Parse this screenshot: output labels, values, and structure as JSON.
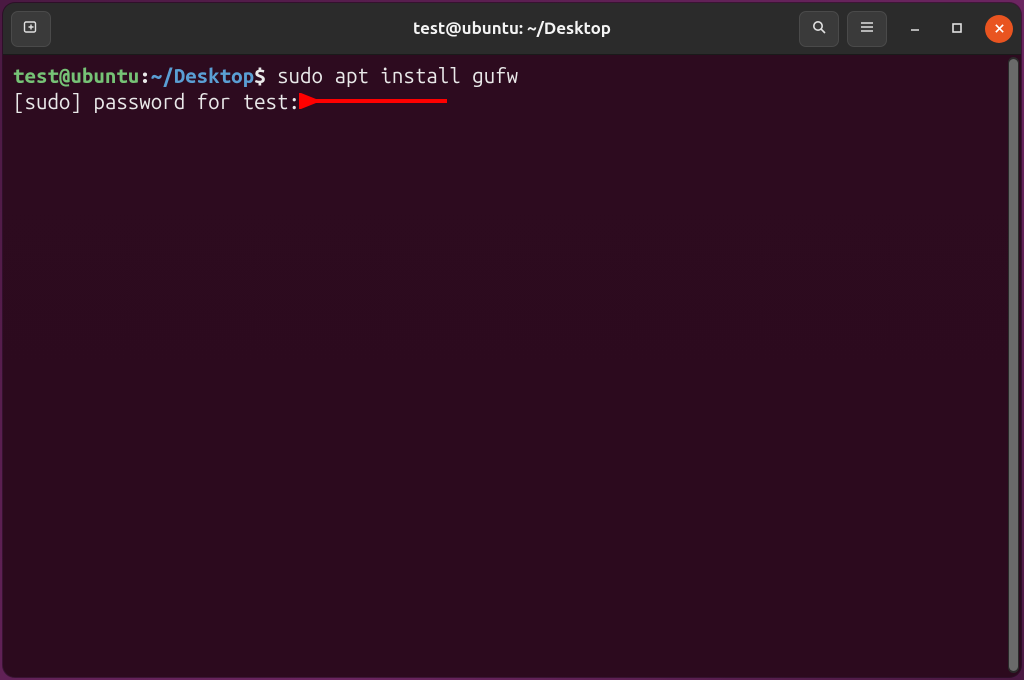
{
  "window": {
    "title": "test@ubuntu: ~/Desktop"
  },
  "toolbar": {
    "new_tab_aria": "New Tab",
    "search_aria": "Search",
    "menu_aria": "Menu",
    "minimize_aria": "Minimize",
    "maximize_aria": "Maximize",
    "close_aria": "Close"
  },
  "prompt": {
    "user_host": "test@ubuntu",
    "separator": ":",
    "path": "~/Desktop",
    "symbol": "$"
  },
  "terminal": {
    "command": "sudo apt install gufw",
    "line2": "[sudo] password for test: "
  },
  "annotation": {
    "arrow_color": "#ff0000"
  }
}
